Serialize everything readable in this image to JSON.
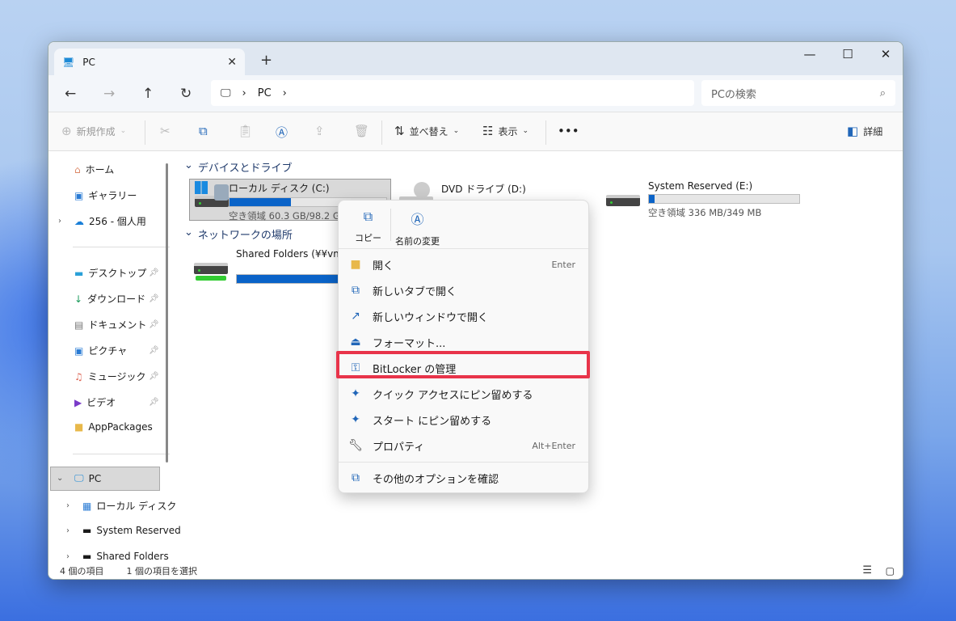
{
  "window": {
    "tab_title": "PC",
    "new_tab": "+",
    "minimize": "—",
    "maximize": "☐",
    "close": "✕"
  },
  "address": {
    "path": [
      "PC"
    ],
    "search_placeholder": "PCの検索"
  },
  "toolbar": {
    "new": "新規作成",
    "sort": "並べ替え",
    "view": "表示",
    "more": "•••",
    "details": "詳細"
  },
  "sidebar": {
    "items": [
      {
        "label": "ホーム"
      },
      {
        "label": "ギャラリー"
      },
      {
        "label": "256 - 個人用"
      },
      {
        "label": "デスクトップ"
      },
      {
        "label": "ダウンロード"
      },
      {
        "label": "ドキュメント"
      },
      {
        "label": "ピクチャ"
      },
      {
        "label": "ミュージック"
      },
      {
        "label": "ビデオ"
      },
      {
        "label": "AppPackages"
      },
      {
        "label": "PC"
      },
      {
        "label": "ローカル ディスク"
      },
      {
        "label": "System Reserved"
      },
      {
        "label": "Shared Folders"
      }
    ]
  },
  "content": {
    "section_devices": "デバイスとドライブ",
    "section_network": "ネットワークの場所",
    "drives": [
      {
        "name": "ローカル ディスク (C:)",
        "free": "空き領域 60.3 GB/98.2 GB",
        "used_percent": 39
      },
      {
        "name": "DVD ドライブ (D:)"
      },
      {
        "name": "System Reserved (E:)",
        "free": "空き領域 336 MB/349 MB",
        "used_percent": 4
      },
      {
        "name": "Shared Folders (¥¥vmware-host) (Z:)",
        "used_percent": 90
      }
    ]
  },
  "status": {
    "count": "4 個の項目",
    "selected": "1 個の項目を選択"
  },
  "context_menu": {
    "quick": [
      {
        "label": "コピー"
      },
      {
        "label": "名前の変更"
      }
    ],
    "items": [
      {
        "label": "開く",
        "shortcut": "Enter"
      },
      {
        "label": "新しいタブで開く"
      },
      {
        "label": "新しいウィンドウで開く"
      },
      {
        "label": "フォーマット..."
      },
      {
        "label": "BitLocker の管理"
      },
      {
        "label": "クイック アクセスにピン留めする"
      },
      {
        "label": "スタート にピン留めする"
      },
      {
        "label": "プロパティ",
        "shortcut": "Alt+Enter"
      },
      {
        "label": "その他のオプションを確認"
      }
    ]
  },
  "colors": {
    "accent": "#0a63c8",
    "highlight": "#e8344a"
  }
}
